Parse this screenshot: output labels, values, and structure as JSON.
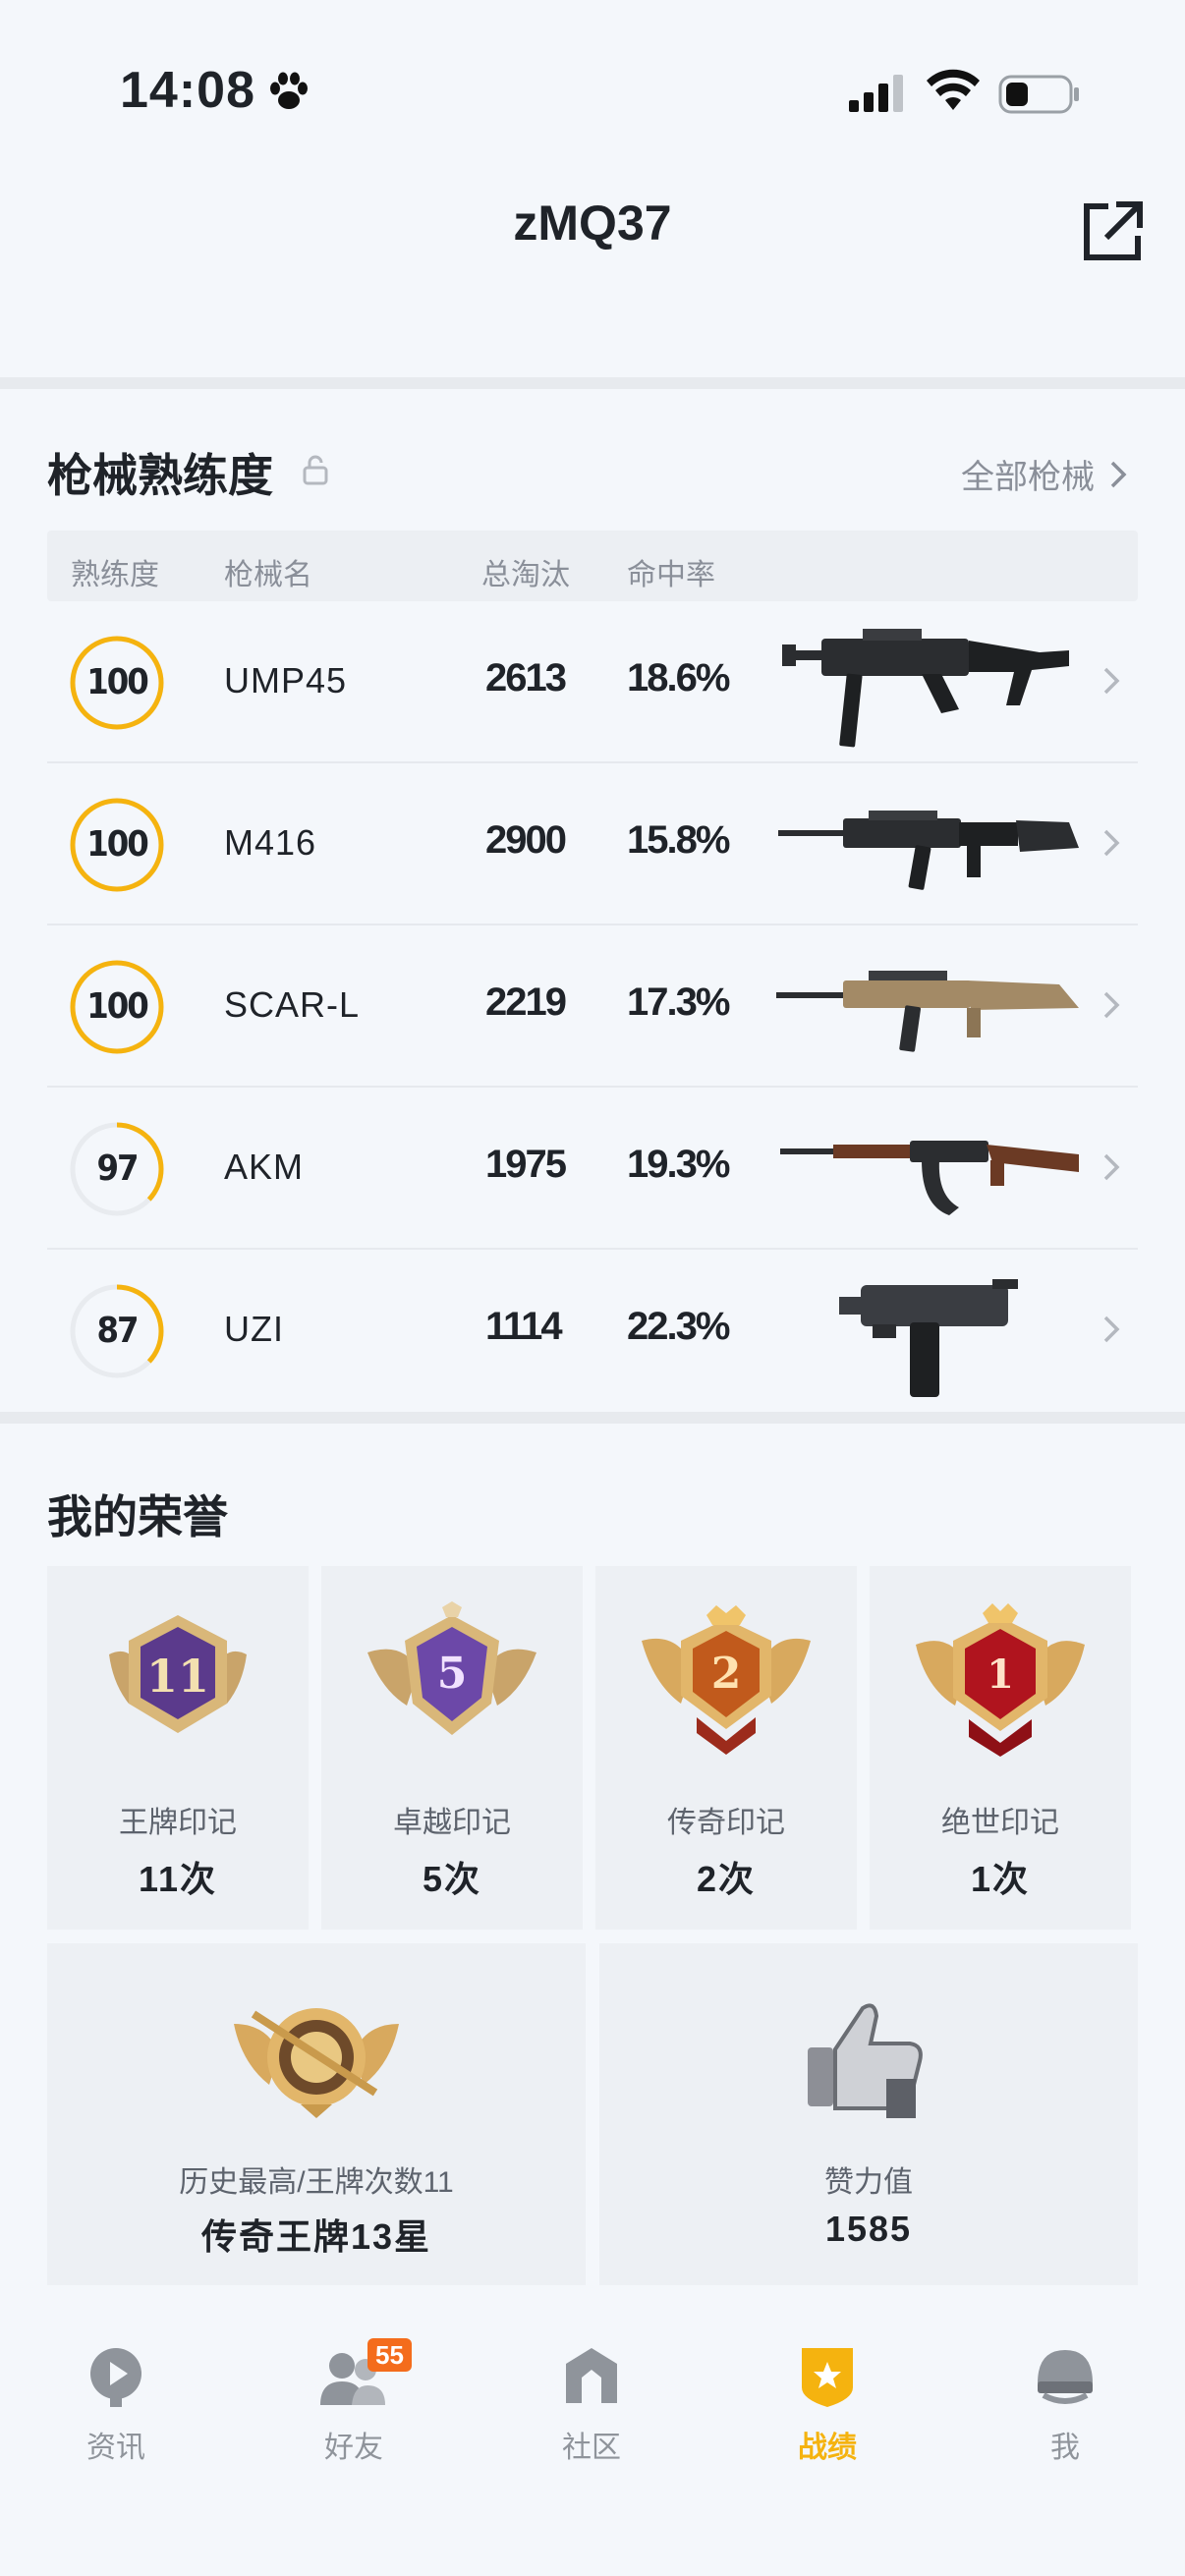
{
  "status_bar": {
    "time": "14:08"
  },
  "header": {
    "title": "zMQ37"
  },
  "weapons": {
    "title": "枪械熟练度",
    "all_link": "全部枪械",
    "columns": [
      "熟练度",
      "枪械名",
      "总淘汰",
      "命中率"
    ],
    "rows": [
      {
        "proficiency": 100,
        "name": "UMP45",
        "kills": "2613",
        "accuracy": "18.6%"
      },
      {
        "proficiency": 100,
        "name": "M416",
        "kills": "2900",
        "accuracy": "15.8%"
      },
      {
        "proficiency": 100,
        "name": "SCAR-L",
        "kills": "2219",
        "accuracy": "17.3%"
      },
      {
        "proficiency": 97,
        "name": "AKM",
        "kills": "1975",
        "accuracy": "19.3%"
      },
      {
        "proficiency": 87,
        "name": "UZI",
        "kills": "1114",
        "accuracy": "22.3%"
      }
    ]
  },
  "honors": {
    "title": "我的荣誉",
    "badges": [
      {
        "label": "王牌印记",
        "value": "11次",
        "emblem_text": "11"
      },
      {
        "label": "卓越印记",
        "value": "5次",
        "emblem_text": "5"
      },
      {
        "label": "传奇印记",
        "value": "2次",
        "emblem_text": "2"
      },
      {
        "label": "绝世印记",
        "value": "1次",
        "emblem_text": "1"
      }
    ],
    "best": {
      "label": "历史最高/王牌次数11",
      "value": "传奇王牌13星"
    },
    "likes": {
      "label": "赞力值",
      "value": "1585"
    }
  },
  "tabbar": {
    "items": [
      {
        "label": "资讯",
        "icon": "news-icon"
      },
      {
        "label": "好友",
        "icon": "friends-icon",
        "badge": "55"
      },
      {
        "label": "社区",
        "icon": "community-icon"
      },
      {
        "label": "战绩",
        "icon": "record-icon",
        "active": true
      },
      {
        "label": "我",
        "icon": "profile-icon"
      }
    ]
  },
  "colors": {
    "accent": "#f5b30f",
    "ring_track": "#e8ebef",
    "badge": "#f46c1c"
  }
}
